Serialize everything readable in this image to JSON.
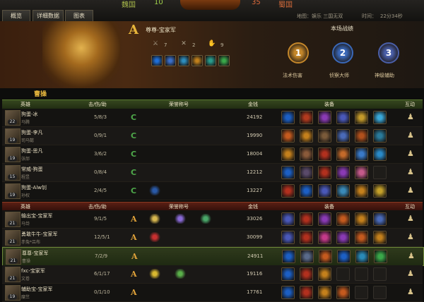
{
  "tabs": [
    "概览",
    "详细数据",
    "图表"
  ],
  "scoreboard": {
    "left_faction": "魏国",
    "left_score": "10",
    "right_score": "35",
    "right_faction": "蜀国"
  },
  "map_label": "地图：娱乐 三国无双",
  "time_label": "时间：",
  "time_value": "22分34秒",
  "hero_panel": {
    "grade": "A",
    "name": "尊尊-宝家军",
    "stat_icons": [
      "sword-icon",
      "cross-swords-icon",
      "hand-icon"
    ],
    "stats": [
      "7",
      "2",
      "9"
    ],
    "skill_colors": [
      "#1e6fd8",
      "#3b6fc8",
      "#2e8dbc",
      "#c0801c",
      "#2a9a8a",
      "#3aa84a"
    ]
  },
  "battle_title": "本场战绩",
  "medals": [
    {
      "num": "1",
      "label": "法术伤害",
      "color": "#c4872a"
    },
    {
      "num": "2",
      "label": "侦察大师",
      "color": "#3a68b8"
    },
    {
      "num": "3",
      "label": "神级辅助",
      "color": "#4a5fa8"
    }
  ],
  "team1_label": "曹操",
  "headers": {
    "hero": "英雄",
    "kda": "击/伤/助",
    "title": "荣誉称号",
    "gold": "金钱",
    "equip": "装备",
    "interact": "互动"
  },
  "team1": [
    {
      "level": "22",
      "name": "狗蛋-冰",
      "hero": "马腾",
      "kda": "5/8/3",
      "mark": "C",
      "badges": [],
      "gold": "24192",
      "items": [
        "#1c5fc4",
        "#b23a1e",
        "#8a3ab4",
        "#4a58b8",
        "#c49a2a",
        "#3aa8d8"
      ]
    },
    {
      "level": "19",
      "name": "狗蛋-李凡",
      "hero": "司马懿",
      "kda": "0/9/1",
      "mark": "C",
      "badges": [],
      "gold": "19990",
      "items": [
        "#c45a1e",
        "#c4801c",
        "#7a5a3a",
        "#4a6ab8",
        "#b0501c",
        "#2a7a9a"
      ]
    },
    {
      "level": "19",
      "name": "狗蛋-思凡",
      "hero": "张郃",
      "kda": "3/6/2",
      "mark": "C",
      "badges": [],
      "gold": "18004",
      "items": [
        "#c4801c",
        "#8a5a3a",
        "#b2301e",
        "#c46a2a",
        "#3a7ac8",
        "#2a8ac8"
      ]
    },
    {
      "level": "15",
      "name": "常威-狗蛋",
      "hero": "程昱",
      "kda": "0/8/4",
      "mark": "C",
      "badges": [],
      "gold": "12212",
      "items": [
        "#1c5fc4",
        "#5a4a6a",
        "#b2301e",
        "#8a3ab4",
        "#c45a8a",
        "#1e1c19"
      ]
    },
    {
      "level": "19",
      "name": "狗蛋-Alw钊",
      "hero": "孙权",
      "kda": "2/4/5",
      "mark": "C",
      "badges": [
        "#2a5aa8"
      ],
      "gold": "13227",
      "items": [
        "#b2301e",
        "#1c5fc4",
        "#4a58b8",
        "#3a8ab8",
        "#c4801c",
        "#c4a02a"
      ]
    }
  ],
  "team2": [
    {
      "level": "21",
      "name": "输出宝-宝家军",
      "hero": "马岱",
      "kda": "9/1/5",
      "mark": "A",
      "badges": [
        "#d8b850",
        "#8a6ad8",
        "#4aa86a"
      ],
      "gold": "33026",
      "items": [
        "#4a58b8",
        "#b2301e",
        "#8a3ab4",
        "#c45a1e",
        "#c4801c",
        "#4a6ab8"
      ]
    },
    {
      "level": "21",
      "name": "勇敢牛牛-宝家军",
      "hero": "赤兔*吕布",
      "kda": "12/5/1",
      "mark": "A",
      "badges": [
        "#c83030"
      ],
      "gold": "30099",
      "items": [
        "#4a58b8",
        "#b2301e",
        "#c43a8a",
        "#8a3ab4",
        "#c45a1e",
        "#c4801c"
      ]
    },
    {
      "level": "21",
      "name": "尊尊-宝家军",
      "hero": "曹操",
      "kda": "7/2/9",
      "mark": "A",
      "badges": [],
      "gold": "24911",
      "selected": true,
      "items": [
        "#1c5fc4",
        "#5a6a8a",
        "#c45a1e",
        "#1c5fc4",
        "#2a8ab8",
        "#3aa84a"
      ]
    },
    {
      "level": "21",
      "name": "fxc-宝家军",
      "hero": "文卷",
      "kda": "6/1/17",
      "mark": "A",
      "badges": [
        "#d8b830",
        "#5ab04a"
      ],
      "gold": "19116",
      "items": [
        "#1c5fc4",
        "#b2301e",
        "#c4801c",
        "#1e1c19",
        "#1e1c19",
        "#1e1c19"
      ]
    },
    {
      "level": "19",
      "name": "辅助宝-宝家军",
      "hero": "糜竺",
      "kda": "0/1/10",
      "mark": "A",
      "badges": [],
      "gold": "17761",
      "items": [
        "#1c5fc4",
        "#b2301e",
        "#c4801c",
        "#c45a1e",
        "#1e1c19",
        "#1e1c19"
      ]
    }
  ]
}
